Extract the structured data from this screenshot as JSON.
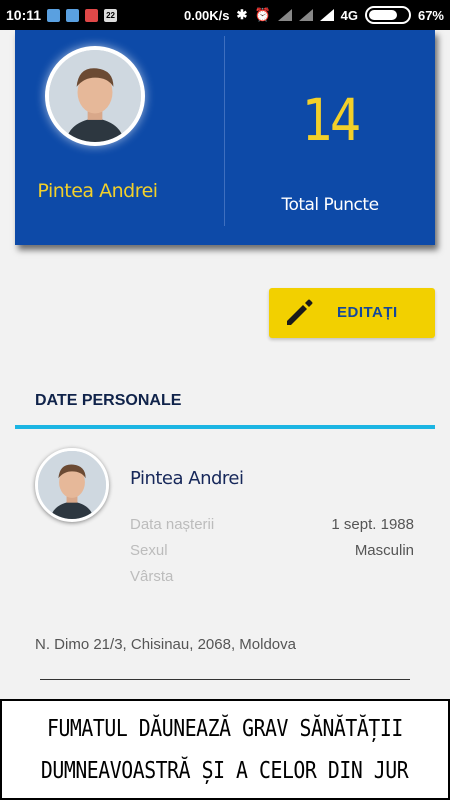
{
  "status_bar": {
    "time": "10:11",
    "calendar_badge": "22",
    "network_speed": "0.00K/s",
    "network_type": "4G",
    "battery": "67%"
  },
  "profile": {
    "name": "Pintea Andrei",
    "points_value": "14",
    "points_label": "Total Puncte"
  },
  "edit_button": {
    "label": "EDITAȚI"
  },
  "personal": {
    "section_title": "DATE PERSONALE",
    "name": "Pintea Andrei",
    "fields": [
      {
        "label": "Data nașterii",
        "value": "1 sept. 1988"
      },
      {
        "label": "Sexul",
        "value": "Masculin"
      },
      {
        "label": "Vârsta",
        "value": ""
      }
    ],
    "address": "N. Dimo 21/3, Chisinau, 2068, Moldova"
  },
  "warning": {
    "line1": "FUMATUL DĂUNEAZĂ GRAV SĂNĂTĂȚII",
    "line2": "DUMNEAVOASTRĂ ȘI A CELOR DIN JUR"
  },
  "colors": {
    "header_blue": "#0d4aa8",
    "accent_yellow": "#f2d02a",
    "button_yellow": "#f2d000",
    "section_line": "#1cb5e3"
  }
}
